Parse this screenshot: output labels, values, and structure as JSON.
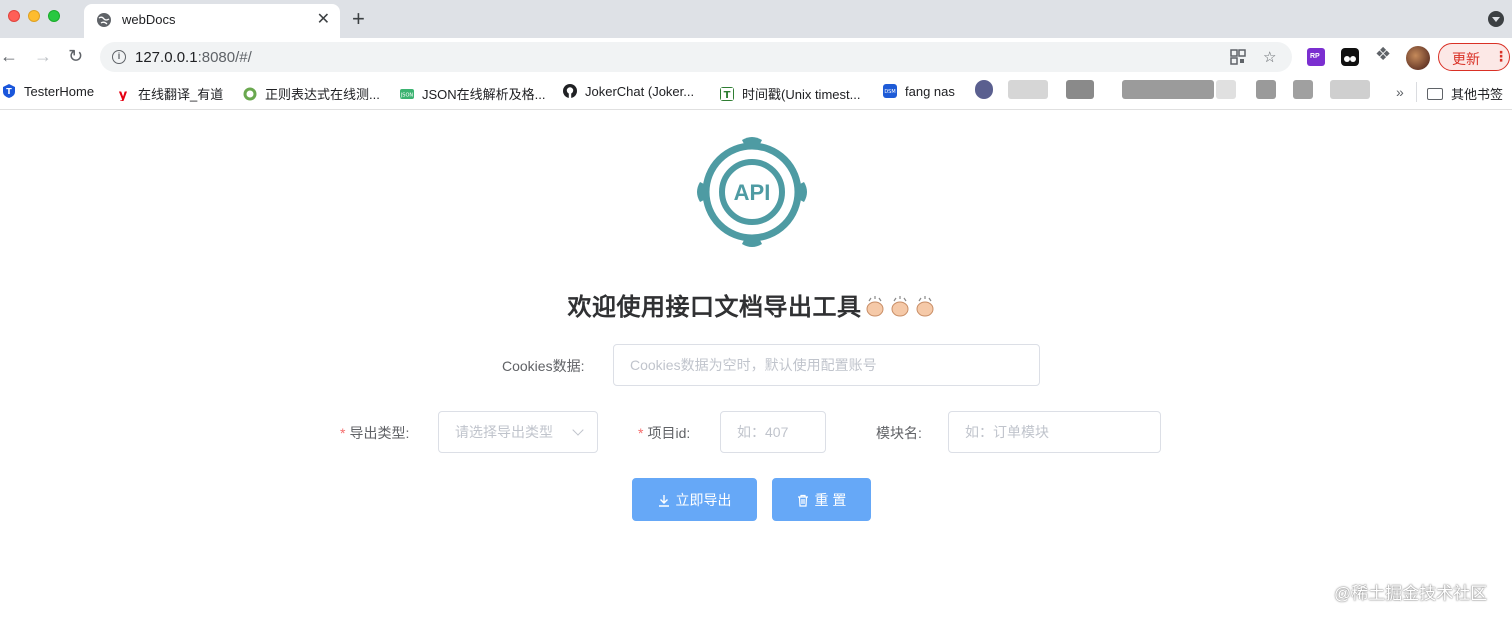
{
  "browser": {
    "tab_title": "webDocs",
    "new_tab_symbol": "+",
    "close_symbol": "✕",
    "url_host": "127.0.0.1",
    "url_rest": ":8080/#/",
    "update_label": "更新",
    "bookmarks": [
      {
        "label": "TesterHome",
        "icon": "testerhome-icon",
        "color": "#1a56db"
      },
      {
        "label": "在线翻译_有道",
        "icon": "youdao-icon",
        "color": "#e60012"
      },
      {
        "label": "正则表达式在线测...",
        "icon": "regex-icon",
        "color": "#6aa84f"
      },
      {
        "label": "JSON在线解析及格...",
        "icon": "json-icon",
        "color": "#3cb371"
      },
      {
        "label": "JokerChat (Joker...",
        "icon": "github-icon",
        "color": "#202124"
      },
      {
        "label": "时间戳(Unix timest...",
        "icon": "timestamp-icon",
        "color": "#2e7d32"
      },
      {
        "label": "fang nas",
        "icon": "dsm-icon",
        "color": "#1e5bd7"
      }
    ],
    "more_bookmarks_symbol": "»",
    "other_bookmarks": "其他书签"
  },
  "page": {
    "logo_text": "API",
    "title": "欢迎使用接口文档导出工具",
    "form": {
      "cookies_label": "Cookies数据:",
      "cookies_placeholder": "Cookies数据为空时，默认使用配置账号",
      "export_type_label": "导出类型:",
      "export_type_placeholder": "请选择导出类型",
      "project_id_label": "项目id:",
      "project_id_placeholder": "如：407",
      "module_label": "模块名:",
      "module_placeholder": "如：订单模块",
      "required_mark": "*"
    },
    "buttons": {
      "export": "立即导出",
      "reset": "重 置"
    }
  },
  "watermark": "@稀土掘金技术社区",
  "colors": {
    "primary_button": "#66a8f7",
    "logo": "#4e9ba3",
    "required": "#f56c6c"
  }
}
